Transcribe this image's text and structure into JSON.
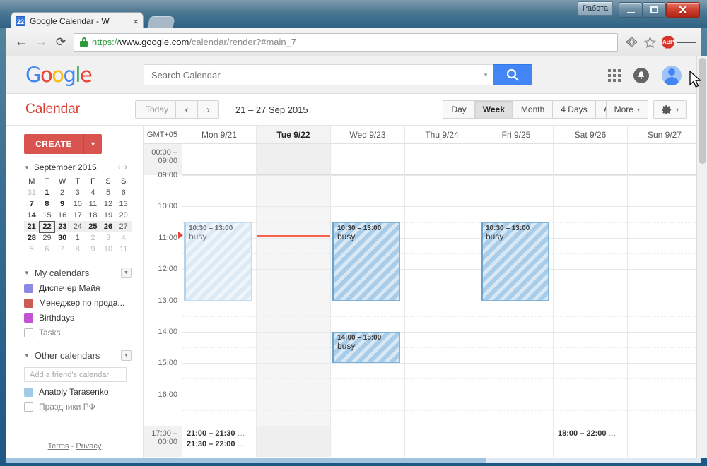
{
  "window": {
    "rabota_label": "Работа",
    "minimize_label": "Minimize",
    "maximize_label": "Maximize",
    "close_label": "✕"
  },
  "browser": {
    "tab": {
      "favicon_text": "22",
      "title": "Google Calendar - W",
      "close": "×"
    },
    "url": {
      "scheme": "https://",
      "host": "www.google.com",
      "path": "/calendar/render?#main_7"
    },
    "back": "←",
    "forward": "→",
    "reload": "⟳",
    "abp_label": "ABP"
  },
  "gbar": {
    "logo": "Google",
    "search_placeholder": "Search Calendar",
    "search_value": ""
  },
  "calbar": {
    "title": "Calendar",
    "today": "Today",
    "prev": "‹",
    "next": "›",
    "daterange": "21 – 27 Sep 2015",
    "views": [
      "Day",
      "Week",
      "Month",
      "4 Days",
      "Agenda"
    ],
    "active_view": "Week",
    "more": "More",
    "caret": "▾"
  },
  "sidebar": {
    "create": "CREATE",
    "create_caret": "▼",
    "minical": {
      "month": "September 2015",
      "prev": "‹",
      "next": "›",
      "weekdays": [
        "M",
        "T",
        "W",
        "T",
        "F",
        "S",
        "S"
      ],
      "weeks": [
        [
          {
            "d": "31",
            "dim": true
          },
          {
            "d": "1",
            "bold": true
          },
          {
            "d": "2"
          },
          {
            "d": "3"
          },
          {
            "d": "4"
          },
          {
            "d": "5"
          },
          {
            "d": "6"
          }
        ],
        [
          {
            "d": "7",
            "bold": true
          },
          {
            "d": "8",
            "bold": true
          },
          {
            "d": "9",
            "bold": true
          },
          {
            "d": "10"
          },
          {
            "d": "11"
          },
          {
            "d": "12"
          },
          {
            "d": "13"
          }
        ],
        [
          {
            "d": "14",
            "bold": true
          },
          {
            "d": "15"
          },
          {
            "d": "16"
          },
          {
            "d": "17"
          },
          {
            "d": "18"
          },
          {
            "d": "19"
          },
          {
            "d": "20"
          }
        ],
        [
          {
            "d": "21",
            "bold": true
          },
          {
            "d": "22",
            "bold": true,
            "today": true
          },
          {
            "d": "23",
            "bold": true
          },
          {
            "d": "24"
          },
          {
            "d": "25",
            "bold": true
          },
          {
            "d": "26",
            "bold": true
          },
          {
            "d": "27"
          }
        ],
        [
          {
            "d": "28",
            "bold": true
          },
          {
            "d": "29"
          },
          {
            "d": "30",
            "bold": true
          },
          {
            "d": "1"
          },
          {
            "d": "2",
            "dim": true
          },
          {
            "d": "3",
            "dim": true
          },
          {
            "d": "4",
            "dim": true
          }
        ],
        [
          {
            "d": "5",
            "dim": true
          },
          {
            "d": "6",
            "dim": true
          },
          {
            "d": "7",
            "dim": true
          },
          {
            "d": "8",
            "dim": true
          },
          {
            "d": "9",
            "dim": true
          },
          {
            "d": "10",
            "dim": true
          },
          {
            "d": "11",
            "dim": true
          }
        ]
      ],
      "selected_week_index": 3
    },
    "my_calendars": {
      "title": "My calendars",
      "items": [
        {
          "label": "Диспечер Майя",
          "color": "#8a8ae6",
          "checked": true
        },
        {
          "label": "Менеджер по прода...",
          "color": "#cc5b52",
          "checked": true
        },
        {
          "label": "Birthdays",
          "color": "#c452d4",
          "checked": true
        },
        {
          "label": "Tasks",
          "color": "",
          "checked": false
        }
      ]
    },
    "other_calendars": {
      "title": "Other calendars",
      "add_placeholder": "Add a friend's calendar",
      "items": [
        {
          "label": "Anatoly Tarasenko",
          "color": "#9fcbe8",
          "checked": true
        },
        {
          "label": "Праздники РФ",
          "color": "",
          "checked": false
        }
      ]
    },
    "footer": {
      "terms": "Terms",
      "sep": "-",
      "privacy": "Privacy"
    }
  },
  "grid": {
    "timezone": "GMT+05",
    "days": [
      {
        "label": "Mon 9/21",
        "today": false
      },
      {
        "label": "Tue 9/22",
        "today": true
      },
      {
        "label": "Wed 9/23",
        "today": false
      },
      {
        "label": "Thu 9/24",
        "today": false
      },
      {
        "label": "Fri 9/25",
        "today": false
      },
      {
        "label": "Sat 9/26",
        "today": false
      },
      {
        "label": "Sun 9/27",
        "today": false
      }
    ],
    "collapsed_top": "00:00 – 09:00",
    "collapsed_bottom": "17:00 – 00:00",
    "hours": [
      "09:00",
      "10:00",
      "11:00",
      "12:00",
      "13:00",
      "14:00",
      "15:00",
      "16:00"
    ],
    "events": [
      {
        "day": 0,
        "time": "10:30 – 13:00",
        "title": "busy",
        "faded": true
      },
      {
        "day": 2,
        "time": "10:30 – 13:00",
        "title": "busy",
        "faded": false
      },
      {
        "day": 4,
        "time": "10:30 – 13:00",
        "title": "busy",
        "faded": false
      },
      {
        "day": 2,
        "time": "14:00 – 15:00",
        "title": "busy",
        "faded": false
      }
    ],
    "stubs": [
      {
        "day": 0,
        "text": "21:00 – 21:30",
        "dots": "…"
      },
      {
        "day": 0,
        "text": "21:30 – 22:00",
        "dots": "…"
      },
      {
        "day": 5,
        "text": "18:00 – 22:00",
        "dots": "…"
      }
    ]
  }
}
